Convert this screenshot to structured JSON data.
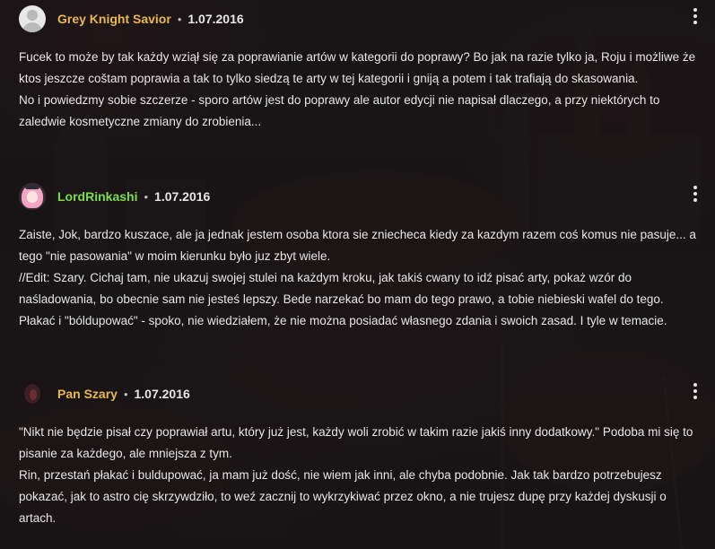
{
  "colors": {
    "username_gold": "#e8b84e",
    "username_green": "#7cde4f",
    "text": "#e6e6e6"
  },
  "separator": "•",
  "comments": [
    {
      "author": "Grey Knight Savior",
      "author_color": "#e8b84e",
      "avatar": "default-user-avatar",
      "date": "1.07.2016",
      "menu_icon": "more-vertical-icon",
      "paragraphs": [
        "Fucek to może by tak każdy wziął się za poprawianie artów w kategorii do poprawy? Bo jak na razie tylko ja, Roju i możliwe że ktos jeszcze coštam poprawia a tak to tylko siedzą te arty w tej kategorii i gniją a potem i tak trafiają do skasowania.",
        "No i powiedzmy sobie szczerze - sporo artów jest do poprawy ale autor edycji nie napisał dlaczego, a przy niektórych to zaledwie kosmetyczne zmiany do zrobienia..."
      ]
    },
    {
      "author": "LordRinkashi",
      "author_color": "#7cde4f",
      "avatar": "pink-hair-anime-avatar",
      "date": "1.07.2016",
      "menu_icon": "more-vertical-icon",
      "paragraphs": [
        "Zaiste, Jok, bardzo kuszace, ale ja jednak jestem osoba ktora sie zniecheca kiedy za kazdym razem coś komus nie pasuje... a tego \"nie pasowania\" w moim kierunku było juz zbyt wiele.",
        "//Edit: Szary. Cichaj tam, nie ukazuj swojej stulei na każdym kroku, jak takiś cwany to idź pisać arty, pokaż wzór do naśladowania, bo obecnie sam nie jesteś lepszy. Bede narzekać bo mam do tego prawo, a tobie niebieski wafel do tego. Płakać i \"bóldupować\" - spoko, nie wiedziałem, że nie można posiadać własnego zdania i swoich zasad. I tyle w temacie."
      ]
    },
    {
      "author": "Pan Szary",
      "author_color": "#e8b84e",
      "avatar": "dark-figure-avatar",
      "date": "1.07.2016",
      "menu_icon": "more-vertical-icon",
      "paragraphs": [
        "\"Nikt nie będzie pisał czy poprawiał artu, który już jest, każdy woli zrobić w takim razie jakiś inny dodatkowy.\" Podoba mi się to pisanie za każdego, ale mniejsza z tym.",
        "Rin, przestań płakać i buldupować, ja mam już dość, nie wiem jak inni, ale chyba podobnie. Jak tak bardzo potrzebujesz pokazać, jak to astro cię skrzywdziło, to weź zacznij to wykrzykiwać przez okno, a nie trujesz dupę przy każdej dyskusji o artach."
      ]
    }
  ]
}
